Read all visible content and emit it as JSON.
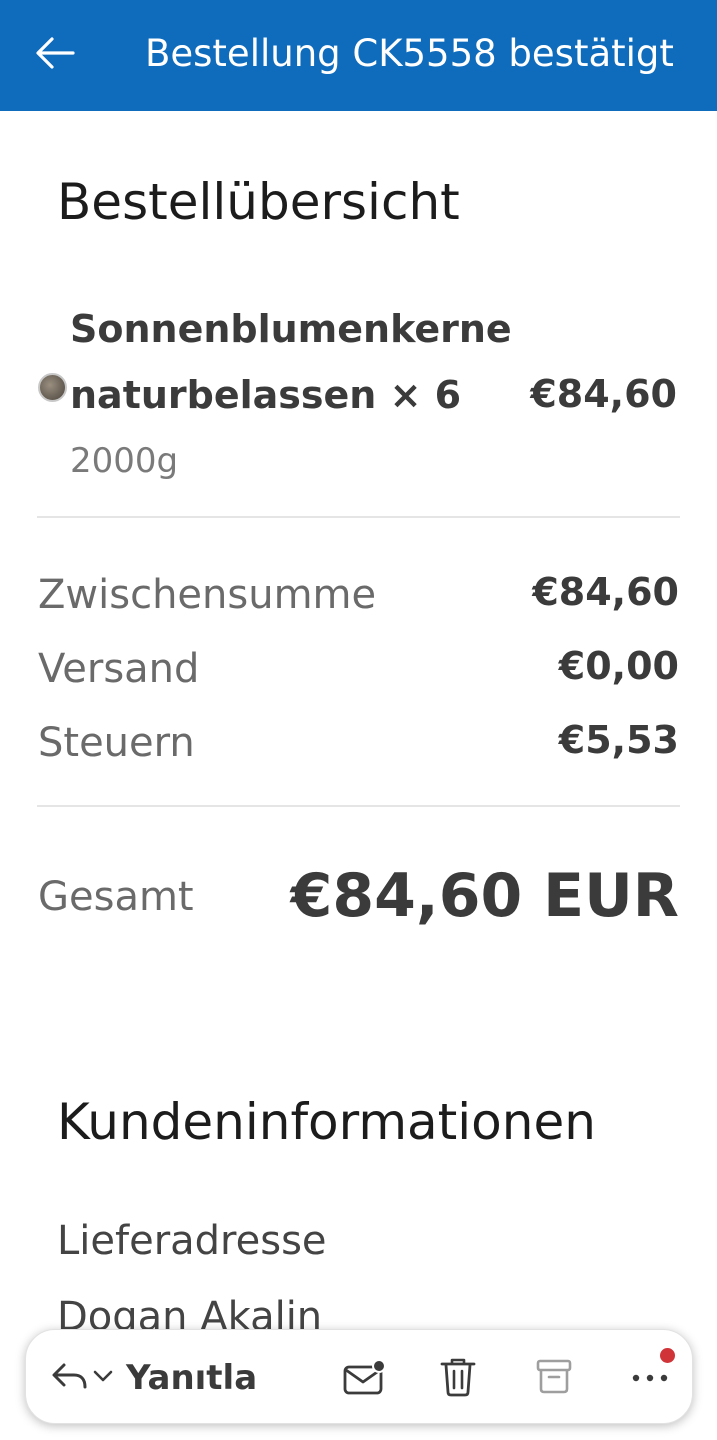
{
  "header": {
    "title": "Bestellung CK5558 bestätigt"
  },
  "order_summary": {
    "heading": "Bestellübersicht",
    "item": {
      "name": "Sonnenblumenkerne naturbelassen × 6",
      "variant": "2000g",
      "price": "€84,60",
      "thumbnail_icon": "sunflower-seeds-thumbnail"
    },
    "subtotal_label": "Zwischensumme",
    "subtotal_value": "€84,60",
    "shipping_label": "Versand",
    "shipping_value": "€0,00",
    "taxes_label": "Steuern",
    "taxes_value": "€5,53",
    "total_label": "Gesamt",
    "total_value": "€84,60 EUR"
  },
  "customer": {
    "heading": "Kundeninformationen",
    "shipping_address_label": "Lieferadresse",
    "name": "Dogan Akalin"
  },
  "toolbar": {
    "reply_label": "Yanıtla",
    "icons": [
      "reply-icon",
      "chevron-down-icon",
      "mail-unread-icon",
      "trash-icon",
      "archive-icon",
      "more-icon"
    ]
  },
  "colors": {
    "header_bg": "#0f6cbd",
    "notification_dot": "#d13438"
  }
}
